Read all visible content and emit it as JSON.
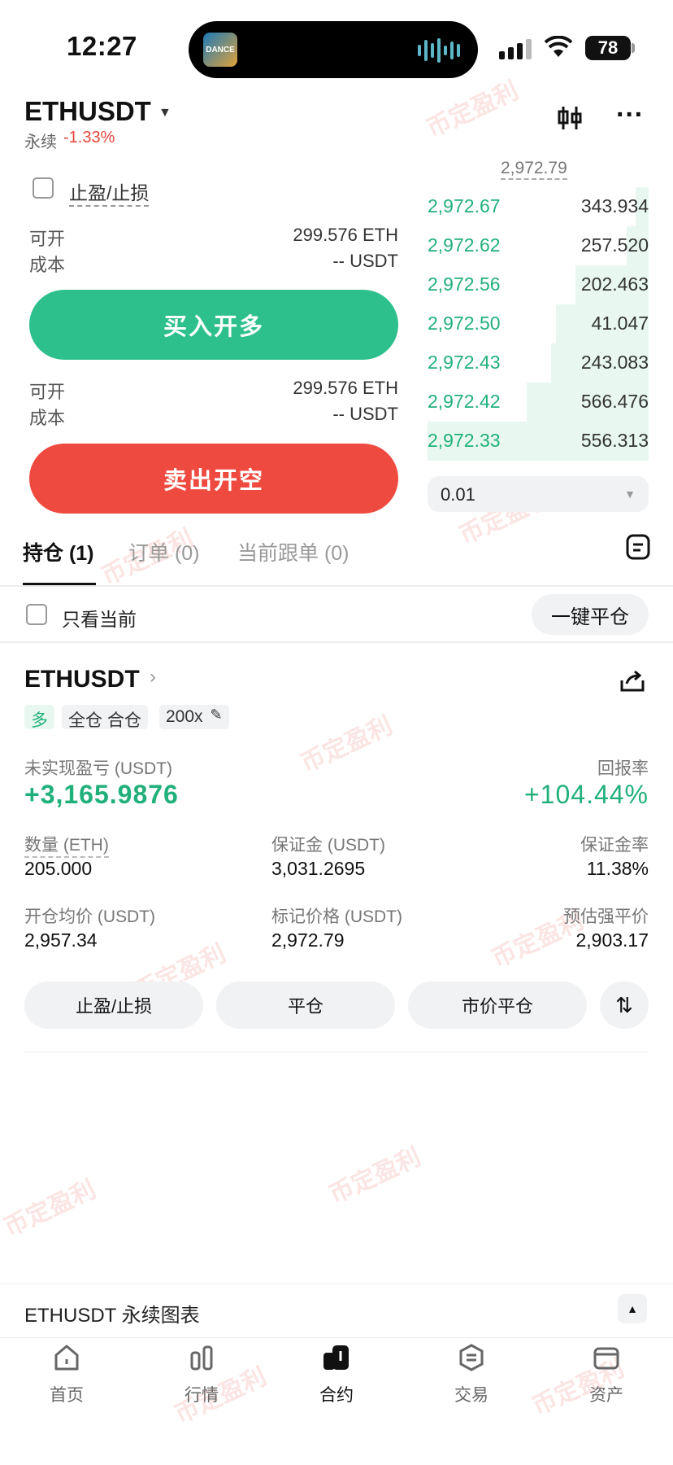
{
  "status_bar": {
    "time": "12:27",
    "now_playing_art": "DANCE",
    "battery": "78"
  },
  "header": {
    "symbol": "ETHUSDT",
    "product": "永续",
    "change": "-1.33%"
  },
  "trade_panel": {
    "tpsl_label": "止盈/止损",
    "long": {
      "open_label": "可开",
      "open_value": "299.576 ETH",
      "cost_label": "成本",
      "cost_value": "-- USDT",
      "button": "买入开多"
    },
    "short": {
      "open_label": "可开",
      "open_value": "299.576 ETH",
      "cost_label": "成本",
      "cost_value": "-- USDT",
      "button": "卖出开空"
    }
  },
  "orderbook": {
    "ref_price": "2,972.79",
    "bids": [
      {
        "price": "2,972.67",
        "qty": "343.934",
        "depth": 0.06
      },
      {
        "price": "2,972.62",
        "qty": "257.520",
        "depth": 0.1
      },
      {
        "price": "2,972.56",
        "qty": "202.463",
        "depth": 0.33
      },
      {
        "price": "2,972.50",
        "qty": "41.047",
        "depth": 0.42
      },
      {
        "price": "2,972.43",
        "qty": "243.083",
        "depth": 0.44
      },
      {
        "price": "2,972.42",
        "qty": "566.476",
        "depth": 0.55
      },
      {
        "price": "2,972.33",
        "qty": "556.313",
        "depth": 1.0
      }
    ],
    "step": "0.01"
  },
  "tabs": [
    {
      "label": "持仓 (1)",
      "active": true
    },
    {
      "label": "订单 (0)",
      "active": false
    },
    {
      "label": "当前跟单 (0)",
      "active": false
    }
  ],
  "filter": {
    "label": "只看当前",
    "close_all": "一键平仓"
  },
  "position": {
    "symbol": "ETHUSDT",
    "tags": [
      "多",
      "全仓 合仓",
      "200x"
    ],
    "pnl_label": "未实现盈亏 (USDT)",
    "pnl_value": "+3,165.9876",
    "roe_label": "回报率",
    "roe_value": "+104.44%",
    "qty_label": "数量 (ETH)",
    "qty_value": "205.000",
    "margin_label": "保证金 (USDT)",
    "margin_value": "3,031.2695",
    "margin_ratio_label": "保证金率",
    "margin_ratio_value": "11.38%",
    "entry_label": "开仓均价 (USDT)",
    "entry_value": "2,957.34",
    "mark_label": "标记价格 (USDT)",
    "mark_value": "2,972.79",
    "liq_label": "预估强平价",
    "liq_value": "2,903.17",
    "actions": [
      "止盈/止损",
      "平仓",
      "市价平仓"
    ]
  },
  "chart_bar": {
    "label": "ETHUSDT 永续图表"
  },
  "bottom_nav": [
    {
      "label": "首页",
      "icon": "home-icon"
    },
    {
      "label": "行情",
      "icon": "market-icon"
    },
    {
      "label": "合约",
      "icon": "futures-icon"
    },
    {
      "label": "交易",
      "icon": "trade-icon"
    },
    {
      "label": "资产",
      "icon": "wallet-icon"
    }
  ],
  "watermark": "币定盈利"
}
